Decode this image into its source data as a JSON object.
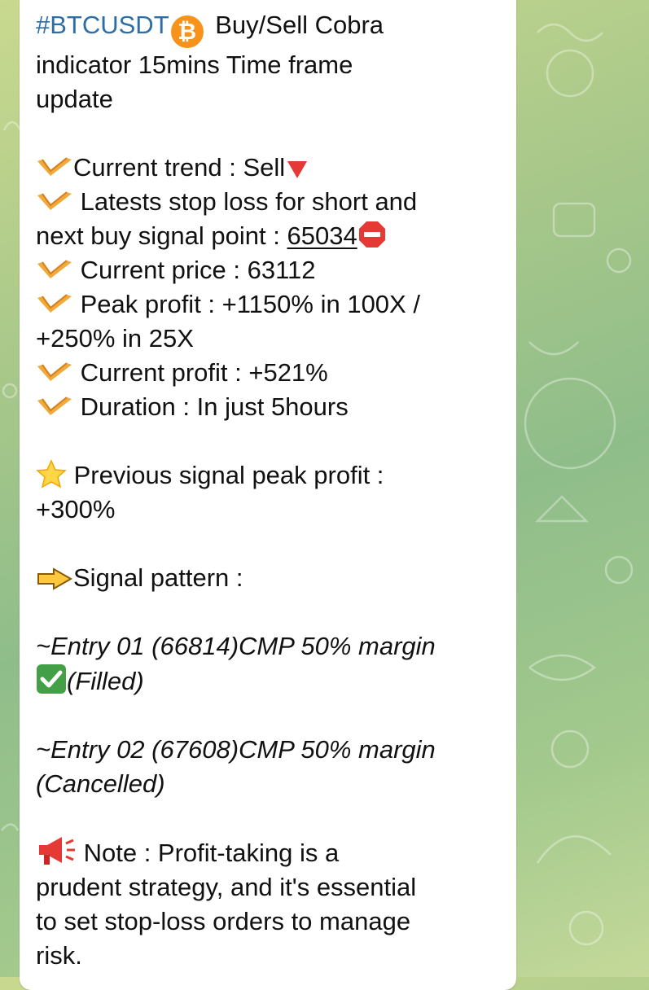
{
  "title": {
    "hashtag": "#BTCUSDT",
    "coin_icon": "bitcoin-icon",
    "rest": " Buy/Sell Cobra",
    "line2": "indicator 15mins Time frame",
    "line3": "update"
  },
  "stats": {
    "bullet_icon": "chevron-check-icon",
    "trend_label": "Current trend : Sell",
    "trend_icon": "red-triangle-down-icon",
    "stoploss_line1": " Latests stop loss for short and",
    "stoploss_line2_prefix": "next buy signal point : ",
    "stoploss_value": "65034",
    "stop_icon": "stop-sign-icon",
    "price": " Current price : 63112",
    "peak_line1": " Peak profit : +1150% in 100X /",
    "peak_line2": "+250% in 25X",
    "current_profit": " Current profit : +521%",
    "duration": " Duration : In just 5hours"
  },
  "previous": {
    "icon": "star-icon",
    "line1": " Previous signal peak profit :",
    "line2": "+300%"
  },
  "pattern": {
    "icon": "pointing-hand-icon",
    "label": "Signal pattern :"
  },
  "entries": {
    "entry1_line1": "~Entry 01 (66814)CMP 50% margin",
    "entry1_icon": "green-check-icon",
    "entry1_line2": "(Filled)",
    "entry2_line1": "~Entry 02 (67608)CMP 50% margin",
    "entry2_line2": "(Cancelled)"
  },
  "note": {
    "icon": "megaphone-icon",
    "line1": " Note : Profit-taking is a",
    "line2": "prudent strategy, and it's essential",
    "line3": "to set stop-loss orders to manage",
    "line4": "risk."
  },
  "colors": {
    "hashtag": "#2f6ea5",
    "bubble": "#ffffff",
    "background": "#a9c88a",
    "bitcoin": "#f7931a"
  }
}
